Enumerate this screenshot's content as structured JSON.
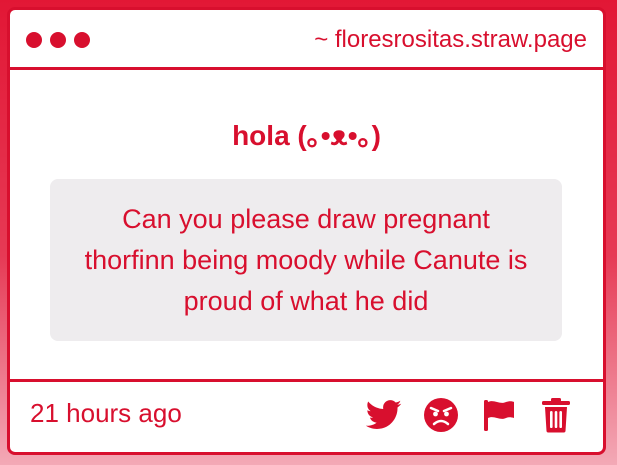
{
  "window": {
    "url": "~ floresrositas.straw.page"
  },
  "greeting": "hola (｡•ᴥ•｡)",
  "message": {
    "text": "Can you please draw pregnant thorfinn being moody while Canute is proud of what he did"
  },
  "footer": {
    "timestamp": "21 hours ago",
    "actions": [
      {
        "icon": "twitter-icon"
      },
      {
        "icon": "angry-face-icon"
      },
      {
        "icon": "flag-icon"
      },
      {
        "icon": "trash-icon"
      }
    ]
  },
  "colors": {
    "accent": "#d80f2e",
    "bubble": "#eeecee",
    "card": "#ffffff"
  }
}
